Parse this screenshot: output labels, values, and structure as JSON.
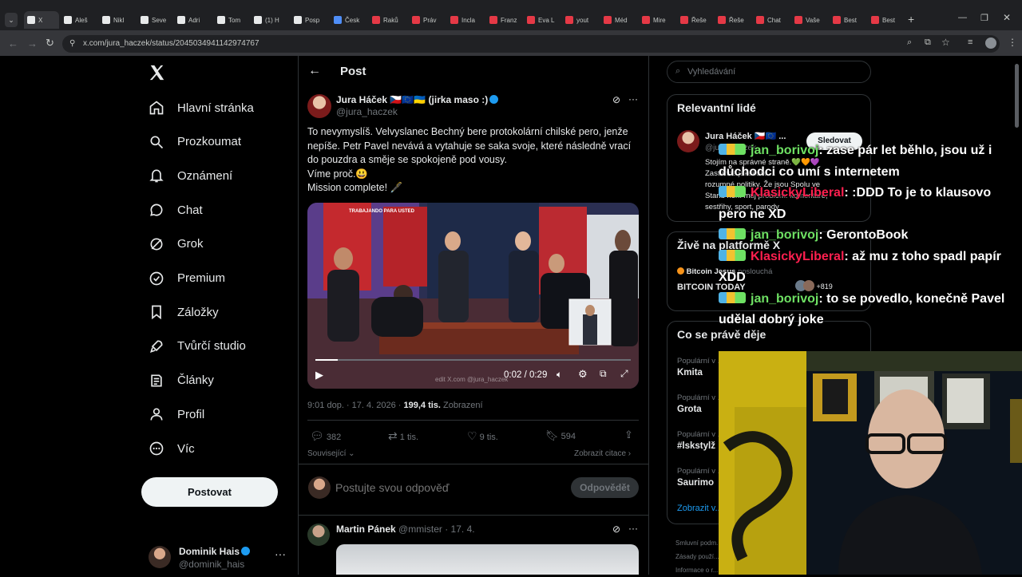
{
  "browser": {
    "tabs": [
      {
        "label": "X",
        "color": "#e7e9ea",
        "active": true
      },
      {
        "label": "Aleš",
        "color": "#e7e9ea"
      },
      {
        "label": "Nikl",
        "color": "#e7e9ea"
      },
      {
        "label": "Seve",
        "color": "#e7e9ea"
      },
      {
        "label": "Adri",
        "color": "#e7e9ea"
      },
      {
        "label": "Tom",
        "color": "#e7e9ea"
      },
      {
        "label": "(1) H",
        "color": "#e7e9ea"
      },
      {
        "label": "Posp",
        "color": "#e7e9ea"
      },
      {
        "label": "Česk",
        "color": "#4f8ef7"
      },
      {
        "label": "Raků",
        "color": "#e53946"
      },
      {
        "label": "Práv",
        "color": "#e53946"
      },
      {
        "label": "Incla",
        "color": "#e53946"
      },
      {
        "label": "Franz",
        "color": "#e53946"
      },
      {
        "label": "Eva L",
        "color": "#e53946"
      },
      {
        "label": "yout",
        "color": "#e53946"
      },
      {
        "label": "Méd",
        "color": "#e53946"
      },
      {
        "label": "Mire",
        "color": "#e53946"
      },
      {
        "label": "Řeše",
        "color": "#e53946"
      },
      {
        "label": "Řeše",
        "color": "#e53946"
      },
      {
        "label": "Chat",
        "color": "#e53946"
      },
      {
        "label": "Vaše",
        "color": "#e53946"
      },
      {
        "label": "Best",
        "color": "#e53946"
      },
      {
        "label": "Best",
        "color": "#e53946"
      }
    ],
    "url": "x.com/jura_haczek/status/2045034941142974767"
  },
  "nav": {
    "items": [
      {
        "label": "Hlavní stránka",
        "icon": "home-icon"
      },
      {
        "label": "Prozkoumat",
        "icon": "search-icon"
      },
      {
        "label": "Oznámení",
        "icon": "bell-icon"
      },
      {
        "label": "Chat",
        "icon": "chat-icon"
      },
      {
        "label": "Grok",
        "icon": "grok-icon"
      },
      {
        "label": "Premium",
        "icon": "premium-icon"
      },
      {
        "label": "Záložky",
        "icon": "bookmark-icon"
      },
      {
        "label": "Tvůrčí studio",
        "icon": "rocket-icon"
      },
      {
        "label": "Články",
        "icon": "article-icon"
      },
      {
        "label": "Profil",
        "icon": "profile-icon"
      },
      {
        "label": "Víc",
        "icon": "more-icon"
      }
    ],
    "post_button": "Postovat",
    "account_name": "Dominik Hais",
    "account_handle": "@dominik_hais"
  },
  "post": {
    "header": "Post",
    "author_name": "Jura Háček 🇨🇿🇪🇺🇺🇦 (jirka maso :)",
    "author_handle": "@jura_haczek",
    "text_1": "To nevymyslíš. Velvyslanec Bechný bere protokolární chilské pero, jenže",
    "text_2": "nepíše. Petr Pavel nevává a vytahuje se saka svoje, které následně vrací",
    "text_3": "do pouzdra a směje se spokojeně pod vousy.",
    "text_4": "Víme proč.😃",
    "text_5": "Mission complete! 🖋️",
    "video_time": "0:02 / 0:29",
    "video_watermark": "edit X.com @jura_haczek",
    "video_caption": "TRABAJANDO PARA USTED",
    "meta_time": "9:01 dop. · 17. 4. 2026 · ",
    "views": "199,4 tis.",
    "views_label": "Zobrazení",
    "replies": "382",
    "reposts": "1 tis.",
    "likes": "9 tis.",
    "bookmarks": "594",
    "related": "Související",
    "show_quotes": "Zobrazit citace",
    "reply_placeholder": "Postujte svou odpověď",
    "reply_button": "Odpovědět",
    "reply_author": "Martin Pánek",
    "reply_handle": "@mmister · 17. 4."
  },
  "sidebar": {
    "search_placeholder": "Vyhledávání",
    "relevant_title": "Relevantní lidé",
    "relevant_name": "Jura Háček 🇨🇿🇪🇺 ...",
    "relevant_handle": "@jura_haczek",
    "follow_button": "Sledovat",
    "relevant_bio_1": "Stojím na správné straně.💚🧡💜",
    "relevant_bio_2": "Zastánce jakékoliv ...",
    "relevant_bio_3": "rozumné politiky. Že jsou Spolu ve",
    "relevant_bio_4": "Stanu není můj problém. komentáře,",
    "relevant_bio_5": "sestřihy, sport, parody",
    "live_title": "Živě na platformě X",
    "live_host": "Bitcoin Jesus",
    "live_listen": "poslouchá",
    "live_name": "BITCOIN TODAY",
    "live_count": "+819",
    "trends_title": "Co se právě děje",
    "trends": [
      {
        "label": "Populární v ...",
        "name": "Kmita"
      },
      {
        "label": "Populární v ...",
        "name": "Grota"
      },
      {
        "label": "Populární v ...",
        "name": "#lskstylž"
      },
      {
        "label": "Populární v ...",
        "name": "Saurimo"
      }
    ],
    "show_more": "Zobrazit v...",
    "footer_1": "Smluvní podm...",
    "footer_2": "Zásady použí...",
    "footer_3": "Informace o r..."
  },
  "chat": {
    "lines": [
      {
        "user": "jan_borivoj",
        "color": "#6ee063",
        "text": ": zase pár let běhlo, jsou už i důchodci co umí s internetem"
      },
      {
        "user": "KlasickyLiberal",
        "color": "#ff1f4f",
        "text": ": :DDD To je to klausovo pero ne XD"
      },
      {
        "user": "jan_borivoj",
        "color": "#6ee063",
        "text": ": GerontoBook"
      },
      {
        "user": "KlasickyLiberal",
        "color": "#ff1f4f",
        "text": ": až mu z toho spadl papír XDD"
      },
      {
        "user": "jan_borivoj",
        "color": "#6ee063",
        "text": ": to se povedlo, konečně Pavel udělal dobrý joke"
      }
    ]
  }
}
